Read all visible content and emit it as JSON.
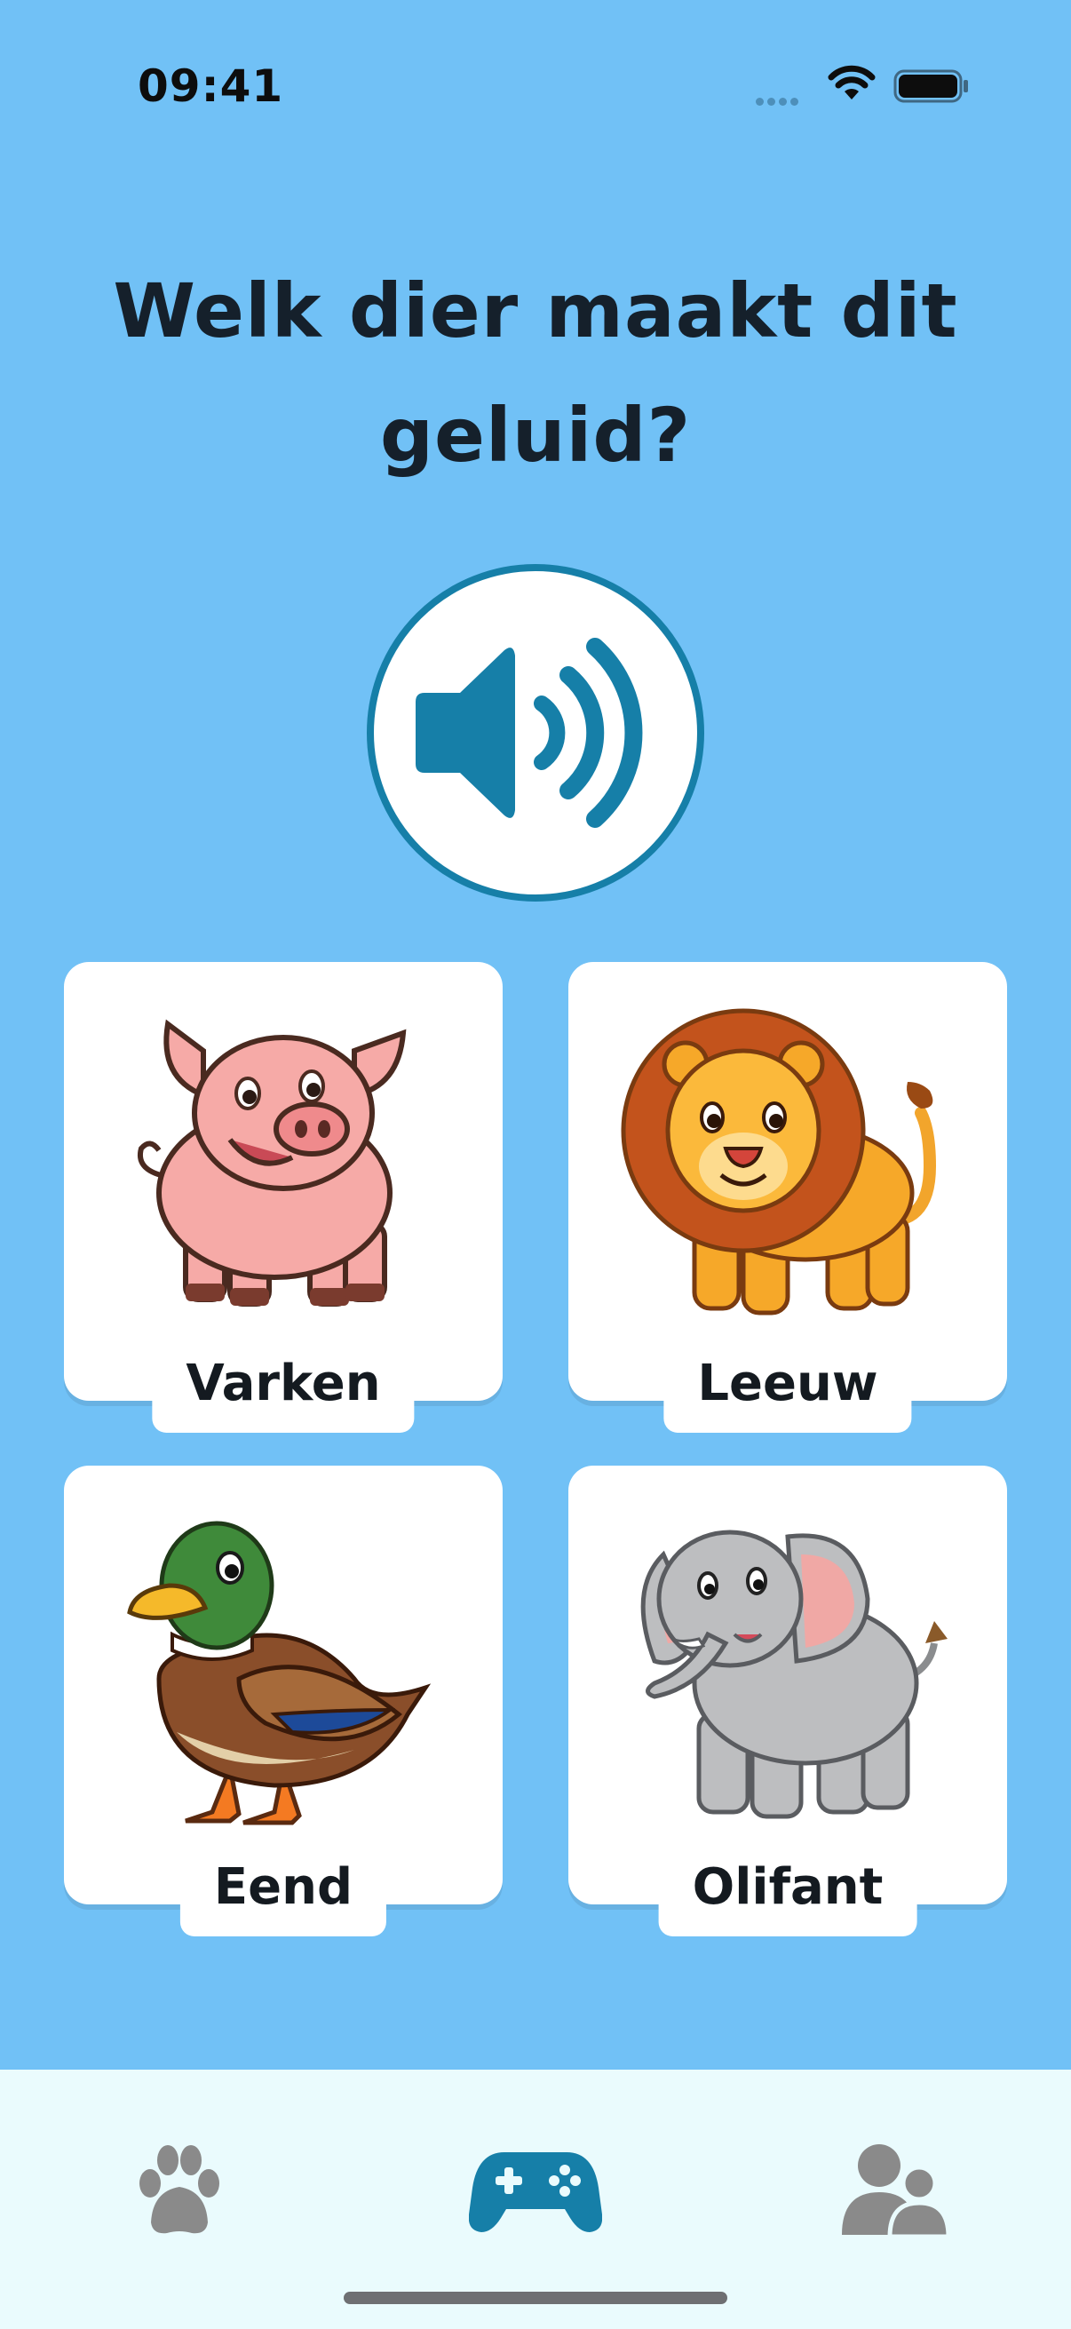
{
  "status_bar": {
    "time": "09:41"
  },
  "question": {
    "text": "Welk dier maakt dit geluid?"
  },
  "sound_button": {
    "icon": "speaker-volume-icon",
    "color": "#167fa8"
  },
  "answers": [
    {
      "label": "Varken",
      "icon": "pig-illustration"
    },
    {
      "label": "Leeuw",
      "icon": "lion-illustration"
    },
    {
      "label": "Eend",
      "icon": "duck-illustration"
    },
    {
      "label": "Olifant",
      "icon": "elephant-illustration"
    }
  ],
  "tab_bar": {
    "tabs": [
      {
        "icon": "paw-icon",
        "active": false
      },
      {
        "icon": "gamepad-icon",
        "active": true
      },
      {
        "icon": "users-icon",
        "active": false
      }
    ],
    "active_color": "#167fa8",
    "inactive_color": "#8a8a8a"
  },
  "colors": {
    "background": "#71c1f6",
    "card": "#ffffff",
    "tab_bar": "#eafbfd"
  }
}
